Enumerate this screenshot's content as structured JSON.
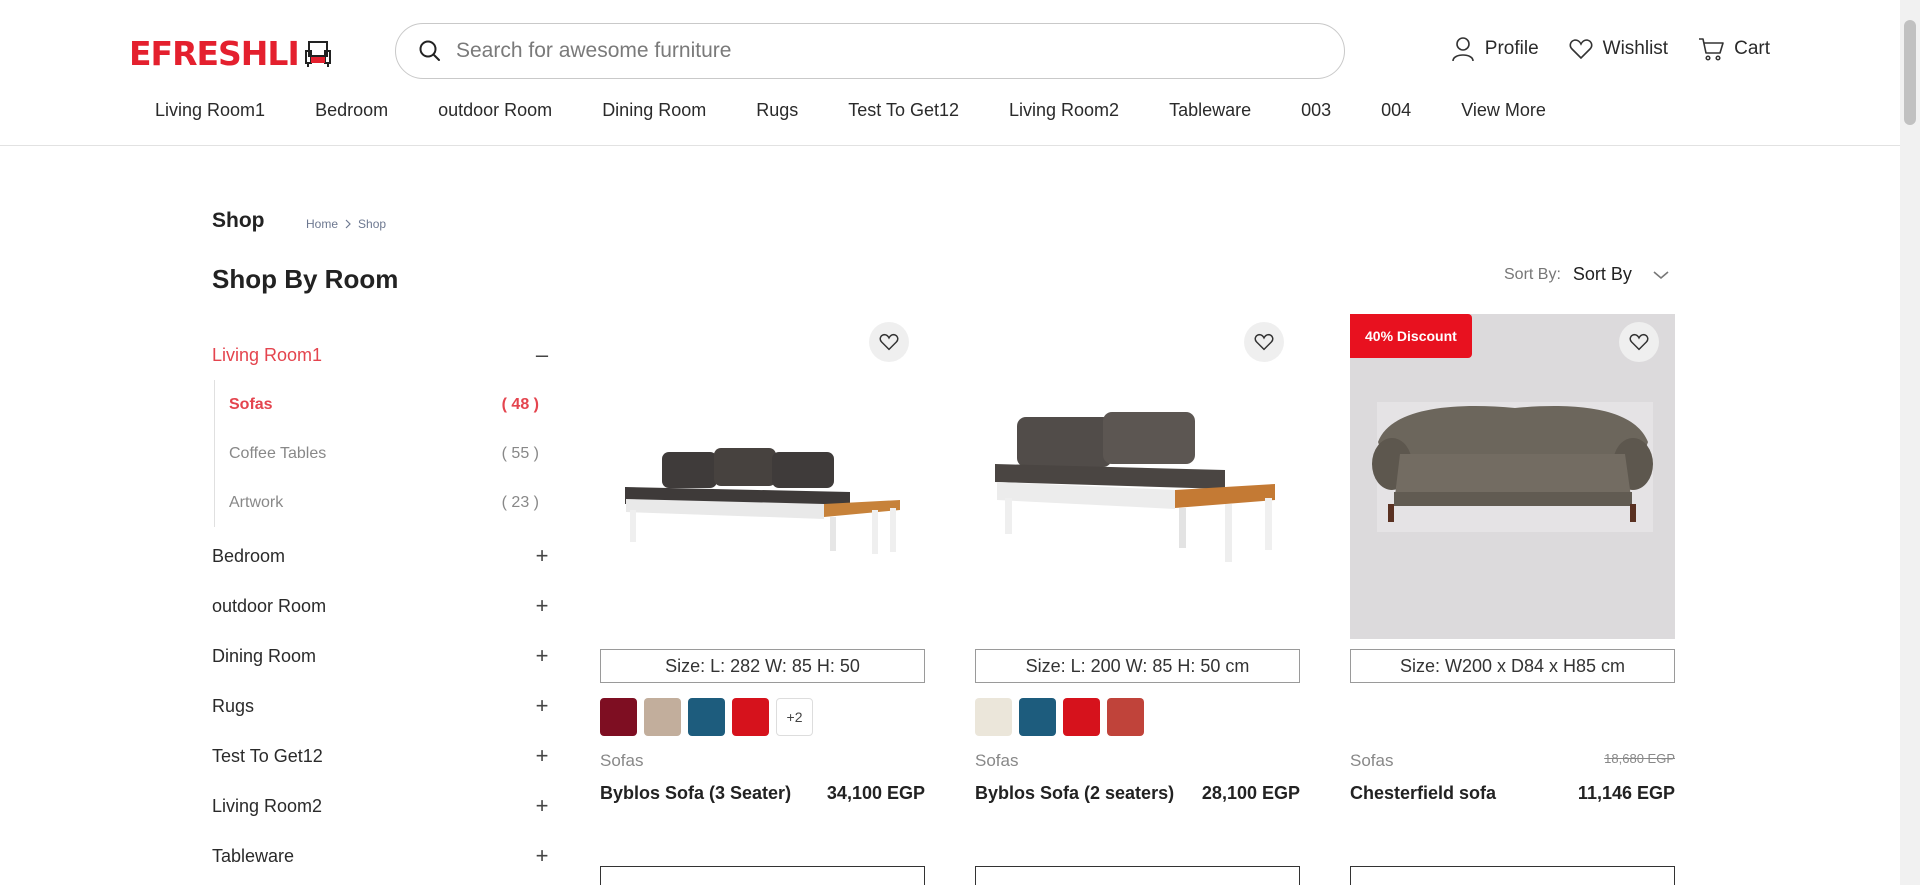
{
  "header": {
    "logo_text": "EFRESHLI",
    "search_placeholder": "Search for awesome furniture",
    "user_nav": [
      {
        "label": "Profile",
        "icon": "user-icon"
      },
      {
        "label": "Wishlist",
        "icon": "heart-icon"
      },
      {
        "label": "Cart",
        "icon": "cart-icon"
      }
    ],
    "categories": [
      "Living Room1",
      "Bedroom",
      "outdoor Room",
      "Dining Room",
      "Rugs",
      "Test To Get12",
      "Living Room2",
      "Tableware",
      "003",
      "004",
      "View More"
    ]
  },
  "breadcrumb": {
    "title": "Shop",
    "items": [
      "Home",
      "Shop"
    ]
  },
  "sidebar": {
    "heading": "Shop By Room",
    "rooms": [
      {
        "label": "Living Room1",
        "toggle": "–",
        "active": true,
        "subcategories": [
          {
            "label": "Sofas",
            "count": "( 48 )",
            "active": true
          },
          {
            "label": "Coffee Tables",
            "count": "( 55 )",
            "active": false
          },
          {
            "label": "Artwork",
            "count": "( 23 )",
            "active": false
          }
        ]
      },
      {
        "label": "Bedroom",
        "toggle": "+"
      },
      {
        "label": "outdoor Room",
        "toggle": "+"
      },
      {
        "label": "Dining Room",
        "toggle": "+"
      },
      {
        "label": "Rugs",
        "toggle": "+"
      },
      {
        "label": "Test To Get12",
        "toggle": "+"
      },
      {
        "label": "Living Room2",
        "toggle": "+"
      },
      {
        "label": "Tableware",
        "toggle": "+"
      }
    ]
  },
  "sort": {
    "label": "Sort By:",
    "value": "Sort By"
  },
  "products": [
    {
      "size": "Size: L: 282 W: 85 H: 50",
      "category": "Sofas",
      "name": "Byblos Sofa (3 Seater)",
      "price": "34,100 EGP",
      "swatches": [
        "#7e0e22",
        "#c2ae9c",
        "#1d5c7d",
        "#d6121c"
      ],
      "more_swatches": "+2"
    },
    {
      "size": "Size: L: 200 W: 85 H: 50 cm",
      "category": "Sofas",
      "name": "Byblos Sofa (2 seaters)",
      "price": "28,100 EGP",
      "swatches": [
        "#ebe6da",
        "#1d5c7d",
        "#d6121c",
        "#c0433a"
      ]
    },
    {
      "badge": "40% Discount",
      "size": "Size: W200 x D84 x H85 cm",
      "category": "Sofas",
      "name": "Chesterfield sofa",
      "price": "11,146 EGP",
      "old_price": "18,680 EGP"
    }
  ],
  "colors": {
    "accent": "#e4202e",
    "discount": "#e8111f"
  }
}
